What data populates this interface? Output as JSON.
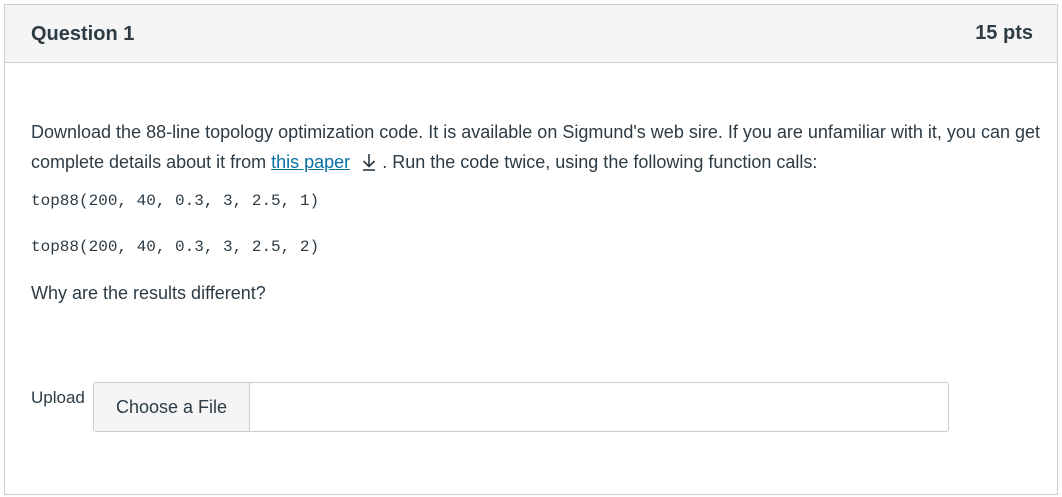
{
  "question": {
    "title": "Question 1",
    "points": "15 pts",
    "text_before_link": "Download the 88-line topology optimization code. It is available on Sigmund's web sire. If you are unfamiliar with it, you can get complete details about it from ",
    "link_text": "this paper",
    "text_after_link": ". Run the code twice, using the following function calls:",
    "code_lines": [
      "top88(200, 40, 0.3, 3, 2.5, 1)",
      "top88(200, 40, 0.3, 3, 2.5, 2)"
    ],
    "follow_up": "Why are the results different?"
  },
  "upload": {
    "label": "Upload",
    "button_label": "Choose a File",
    "file_name": ""
  },
  "colors": {
    "link": "#0770a3",
    "text": "#2d3b45",
    "header_bg": "#f5f5f5",
    "border": "#c7cdd1"
  },
  "icons": {
    "download": "download-icon"
  }
}
